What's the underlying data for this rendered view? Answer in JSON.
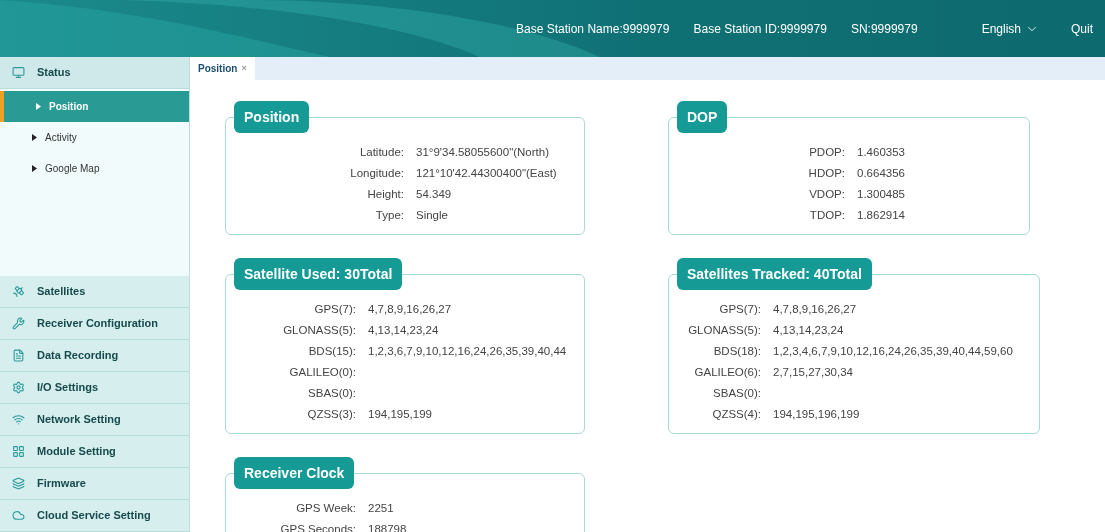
{
  "header": {
    "items": [
      {
        "kind": "info",
        "text": "Base Station Name:9999979"
      },
      {
        "kind": "info",
        "text": "Base Station ID:9999979"
      },
      {
        "kind": "info",
        "text": "SN:9999979"
      },
      {
        "kind": "language",
        "text": "English"
      },
      {
        "kind": "link",
        "text": "Quit"
      }
    ]
  },
  "sidebar": {
    "groups": [
      {
        "label": "Status",
        "expanded": true,
        "children": [
          {
            "label": "Position",
            "selected": true
          },
          {
            "label": "Activity",
            "selected": false
          },
          {
            "label": "Google Map",
            "selected": false
          }
        ]
      },
      {
        "label": "Satellites"
      },
      {
        "label": "Receiver Configuration"
      },
      {
        "label": "Data Recording"
      },
      {
        "label": "I/O Settings"
      },
      {
        "label": "Network Setting"
      },
      {
        "label": "Module Setting"
      },
      {
        "label": "Firmware"
      },
      {
        "label": "Cloud Service Setting"
      }
    ]
  },
  "tabs": [
    {
      "label": "Position",
      "close": "×",
      "selected": true
    }
  ],
  "columns": [
    [
      {
        "title": "Position",
        "rows": [
          {
            "label": "Latitude:",
            "value": "31°9'34.58055600\"(North)"
          },
          {
            "label": "Longitude:",
            "value": "121°10'42.44300400\"(East)"
          },
          {
            "label": "Height:",
            "value": "54.349"
          },
          {
            "label": "Type:",
            "value": "Single"
          }
        ]
      },
      {
        "title": "Satellite Used:  30Total",
        "rows": [
          {
            "label": "GPS(7):",
            "value": "4,7,8,9,16,26,27"
          },
          {
            "label": "GLONASS(5):",
            "value": "4,13,14,23,24"
          },
          {
            "label": "BDS(15):",
            "value": "1,2,3,6,7,9,10,12,16,24,26,35,39,40,44"
          },
          {
            "label": "GALILEO(0):"
          },
          {
            "label": "SBAS(0):"
          },
          {
            "label": "QZSS(3):",
            "value": "194,195,199"
          }
        ]
      },
      {
        "title": "Receiver Clock",
        "rows": [
          {
            "label": "GPS Week:",
            "value": "2251"
          },
          {
            "label": "GPS Seconds:",
            "value": "188798"
          }
        ]
      }
    ],
    [
      {
        "title": "DOP",
        "rows": [
          {
            "label": "PDOP:",
            "value": "1.460353"
          },
          {
            "label": "HDOP:",
            "value": "0.664356"
          },
          {
            "label": "VDOP:",
            "value": "1.300485"
          },
          {
            "label": "TDOP:",
            "value": "1.862914"
          }
        ]
      },
      {
        "title": "Satellites Tracked:  40Total",
        "rows": [
          {
            "label": "GPS(7):",
            "value": "4,7,8,9,16,26,27"
          },
          {
            "label": "GLONASS(5):",
            "value": "4,13,14,23,24"
          },
          {
            "label": "BDS(18):",
            "value": "1,2,3,4,6,7,9,10,12,16,24,26,35,39,40,44,59,60"
          },
          {
            "label": "GALILEO(6):",
            "value": "2,7,15,27,30,34"
          },
          {
            "label": "SBAS(0):"
          },
          {
            "label": "QZSS(4):",
            "value": "194,195,196,199"
          }
        ]
      }
    ]
  ]
}
